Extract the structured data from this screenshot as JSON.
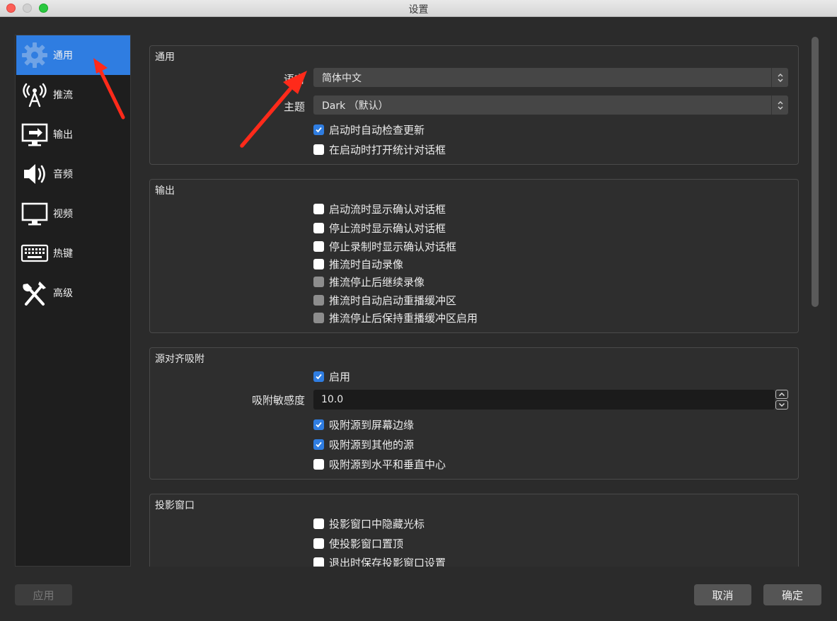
{
  "window": {
    "title": "设置"
  },
  "sidebar": {
    "items": [
      {
        "label": "通用",
        "icon": "gear-icon",
        "active": true
      },
      {
        "label": "推流",
        "icon": "antenna-icon",
        "active": false
      },
      {
        "label": "输出",
        "icon": "output-monitor-icon",
        "active": false
      },
      {
        "label": "音频",
        "icon": "speaker-icon",
        "active": false
      },
      {
        "label": "视频",
        "icon": "monitor-icon",
        "active": false
      },
      {
        "label": "热键",
        "icon": "keyboard-icon",
        "active": false
      },
      {
        "label": "高级",
        "icon": "tools-icon",
        "active": false
      }
    ]
  },
  "general": {
    "title": "通用",
    "language_label": "语言",
    "language_value": "简体中文",
    "theme_label": "主题",
    "theme_value": "Dark （默认）",
    "checkboxes": [
      {
        "label": "启动时自动检查更新",
        "checked": true
      },
      {
        "label": "在启动时打开统计对话框",
        "checked": false
      }
    ]
  },
  "output": {
    "title": "输出",
    "checkboxes": [
      {
        "label": "启动流时显示确认对话框",
        "checked": false,
        "disabled": false
      },
      {
        "label": "停止流时显示确认对话框",
        "checked": false,
        "disabled": false
      },
      {
        "label": "停止录制时显示确认对话框",
        "checked": false,
        "disabled": false
      },
      {
        "label": "推流时自动录像",
        "checked": false,
        "disabled": false
      },
      {
        "label": "推流停止后继续录像",
        "checked": false,
        "disabled": true
      },
      {
        "label": "推流时自动启动重播缓冲区",
        "checked": false,
        "disabled": true
      },
      {
        "label": "推流停止后保持重播缓冲区启用",
        "checked": false,
        "disabled": true
      }
    ]
  },
  "snapping": {
    "title": "源对齐吸附",
    "enable_label": "启用",
    "enable_checked": true,
    "sensitivity_label": "吸附敏感度",
    "sensitivity_value": "10.0",
    "checkboxes": [
      {
        "label": "吸附源到屏幕边缘",
        "checked": true
      },
      {
        "label": "吸附源到其他的源",
        "checked": true
      },
      {
        "label": "吸附源到水平和垂直中心",
        "checked": false
      }
    ]
  },
  "projector": {
    "title": "投影窗口",
    "checkboxes": [
      {
        "label": "投影窗口中隐藏光标",
        "checked": false
      },
      {
        "label": "使投影窗口置顶",
        "checked": false
      },
      {
        "label": "退出时保存投影窗口设置",
        "checked": false
      }
    ]
  },
  "buttons": {
    "apply": "应用",
    "cancel": "取消",
    "ok": "确定"
  },
  "colors": {
    "accent": "#2f7de1",
    "annotation": "#ff2a1a"
  }
}
